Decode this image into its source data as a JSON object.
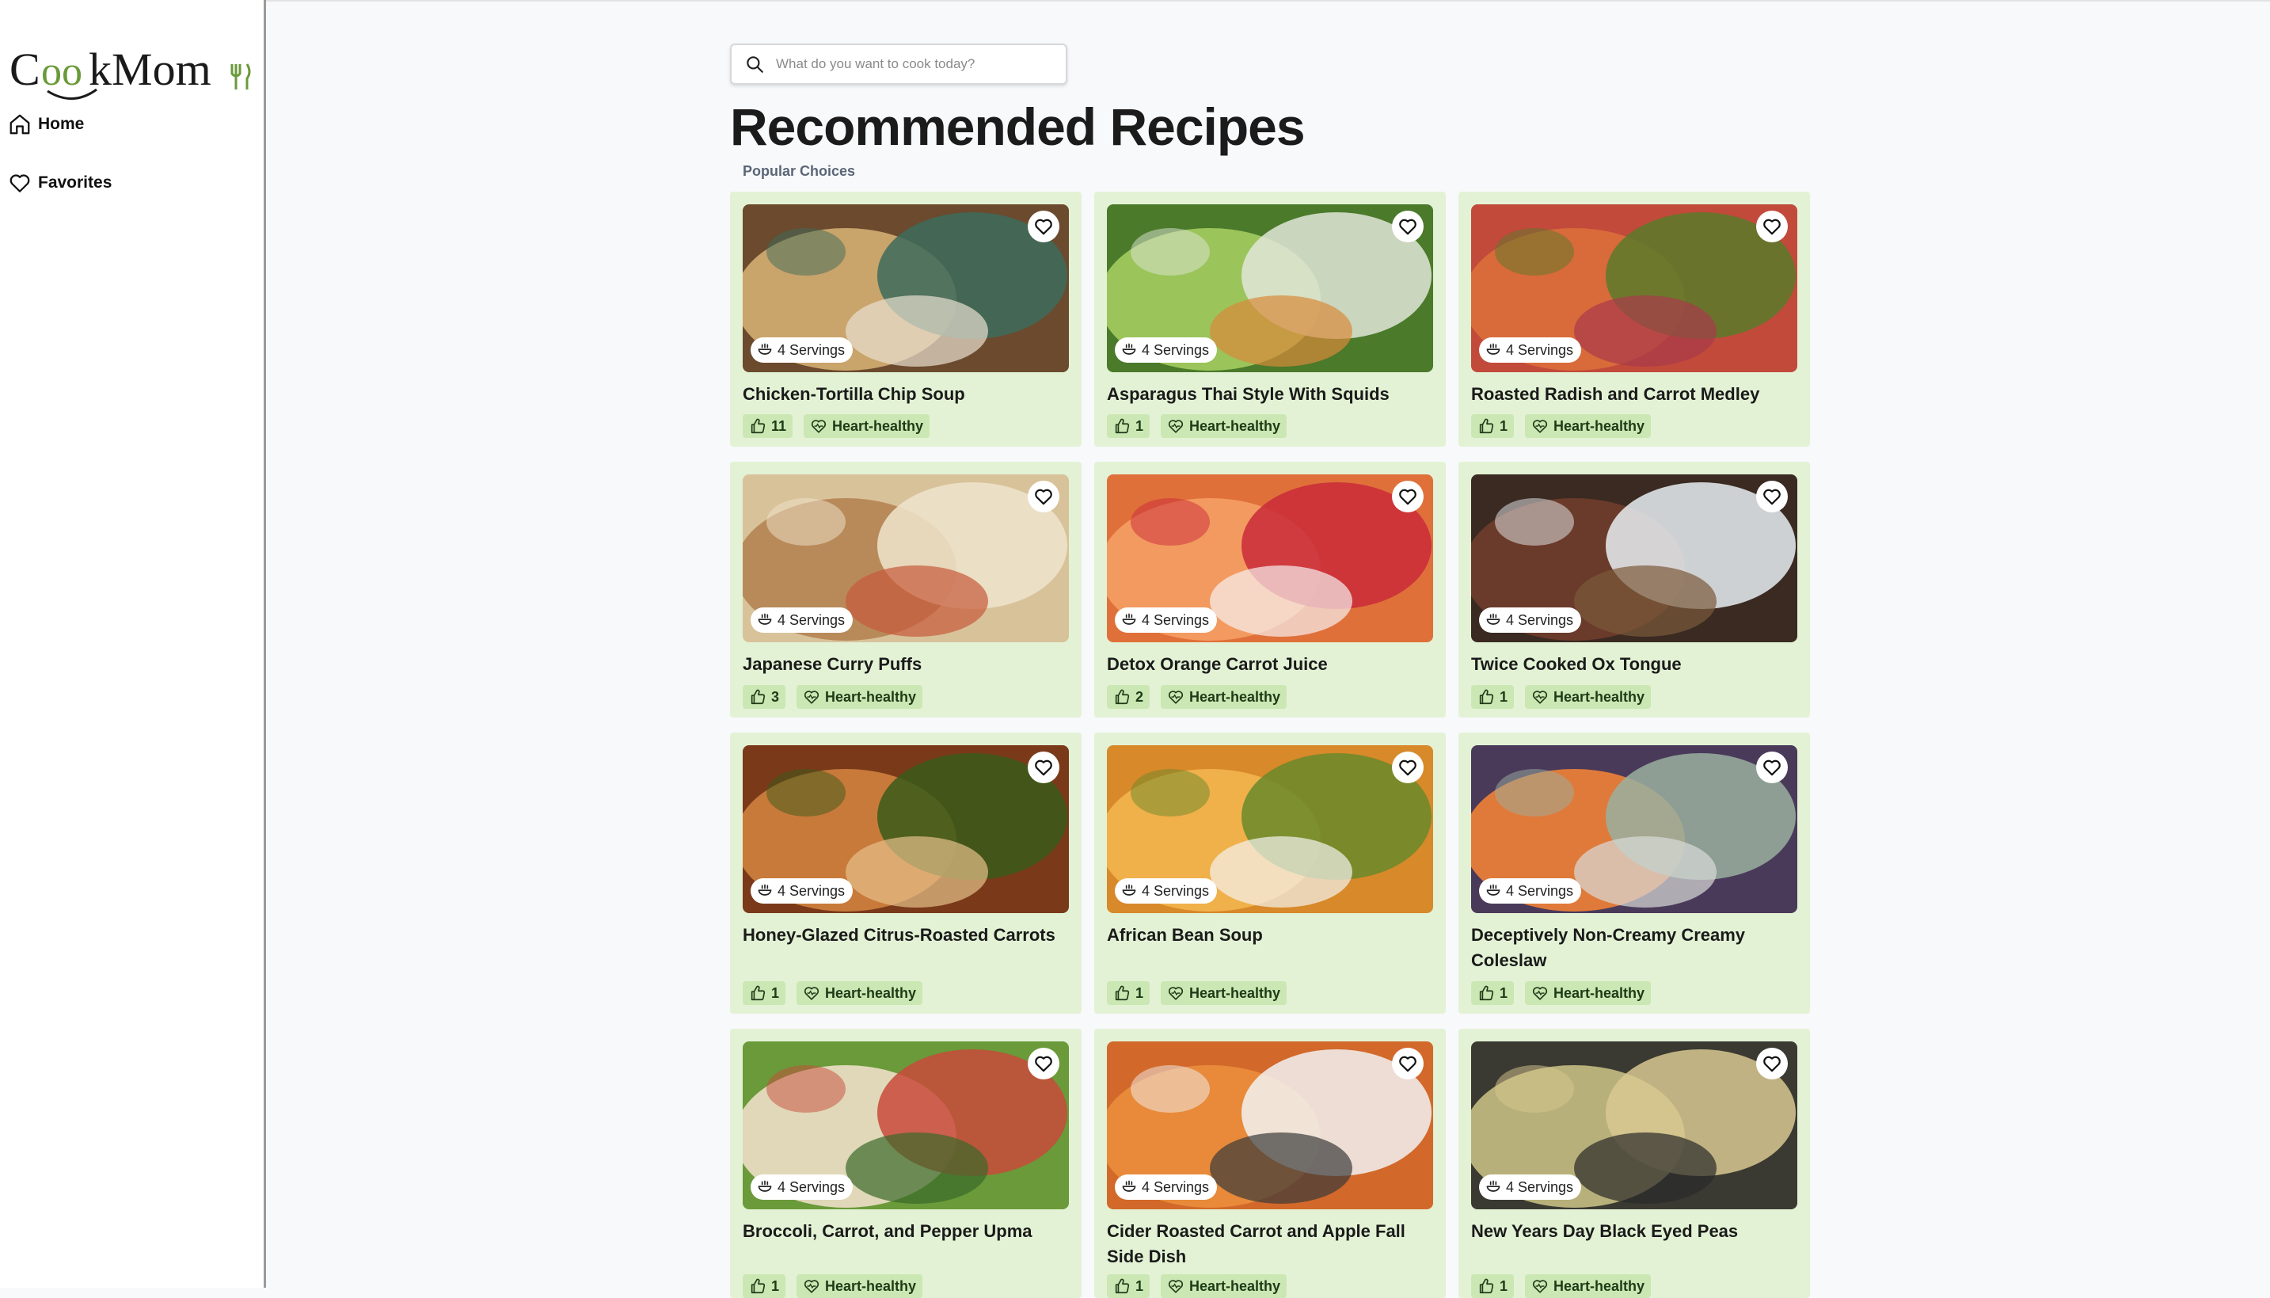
{
  "app": {
    "logo_text": "CookMom"
  },
  "sidebar": {
    "items": [
      {
        "label": "Home",
        "icon": "home-icon"
      },
      {
        "label": "Favorites",
        "icon": "heart-icon"
      }
    ]
  },
  "search": {
    "placeholder": "What do you want to cook today?",
    "value": ""
  },
  "main": {
    "title": "Recommended Recipes",
    "subtitle": "Popular Choices",
    "recipes": [
      {
        "title": "Chicken-Tortilla Chip Soup",
        "servings": "4 Servings",
        "likes": "11",
        "tag": "Heart-healthy"
      },
      {
        "title": "Asparagus Thai Style With Squids",
        "servings": "4 Servings",
        "likes": "1",
        "tag": "Heart-healthy"
      },
      {
        "title": "Roasted Radish and Carrot Medley",
        "servings": "4 Servings",
        "likes": "1",
        "tag": "Heart-healthy"
      },
      {
        "title": "Japanese Curry Puffs",
        "servings": "4 Servings",
        "likes": "3",
        "tag": "Heart-healthy"
      },
      {
        "title": "Detox Orange Carrot Juice",
        "servings": "4 Servings",
        "likes": "2",
        "tag": "Heart-healthy"
      },
      {
        "title": "Twice Cooked Ox Tongue",
        "servings": "4 Servings",
        "likes": "1",
        "tag": "Heart-healthy"
      },
      {
        "title": "Honey-Glazed Citrus-Roasted Carrots",
        "servings": "4 Servings",
        "likes": "1",
        "tag": "Heart-healthy"
      },
      {
        "title": "African Bean Soup",
        "servings": "4 Servings",
        "likes": "1",
        "tag": "Heart-healthy"
      },
      {
        "title": "Deceptively Non-Creamy Creamy Coleslaw",
        "servings": "4 Servings",
        "likes": "1",
        "tag": "Heart-healthy"
      },
      {
        "title": "Broccoli, Carrot, and Pepper Upma",
        "servings": "4 Servings",
        "likes": "1",
        "tag": "Heart-healthy"
      },
      {
        "title": "Cider Roasted Carrot and Apple Fall Side Dish",
        "servings": "4 Servings",
        "likes": "1",
        "tag": "Heart-healthy"
      },
      {
        "title": "New Years Day Black Eyed Peas",
        "servings": "4 Servings",
        "likes": "1",
        "tag": "Heart-healthy"
      }
    ]
  },
  "colors": {
    "card_bg": "#e3f2d5",
    "pill_bg": "#cbe7b3",
    "logo_accent": "#6a9a3a"
  }
}
